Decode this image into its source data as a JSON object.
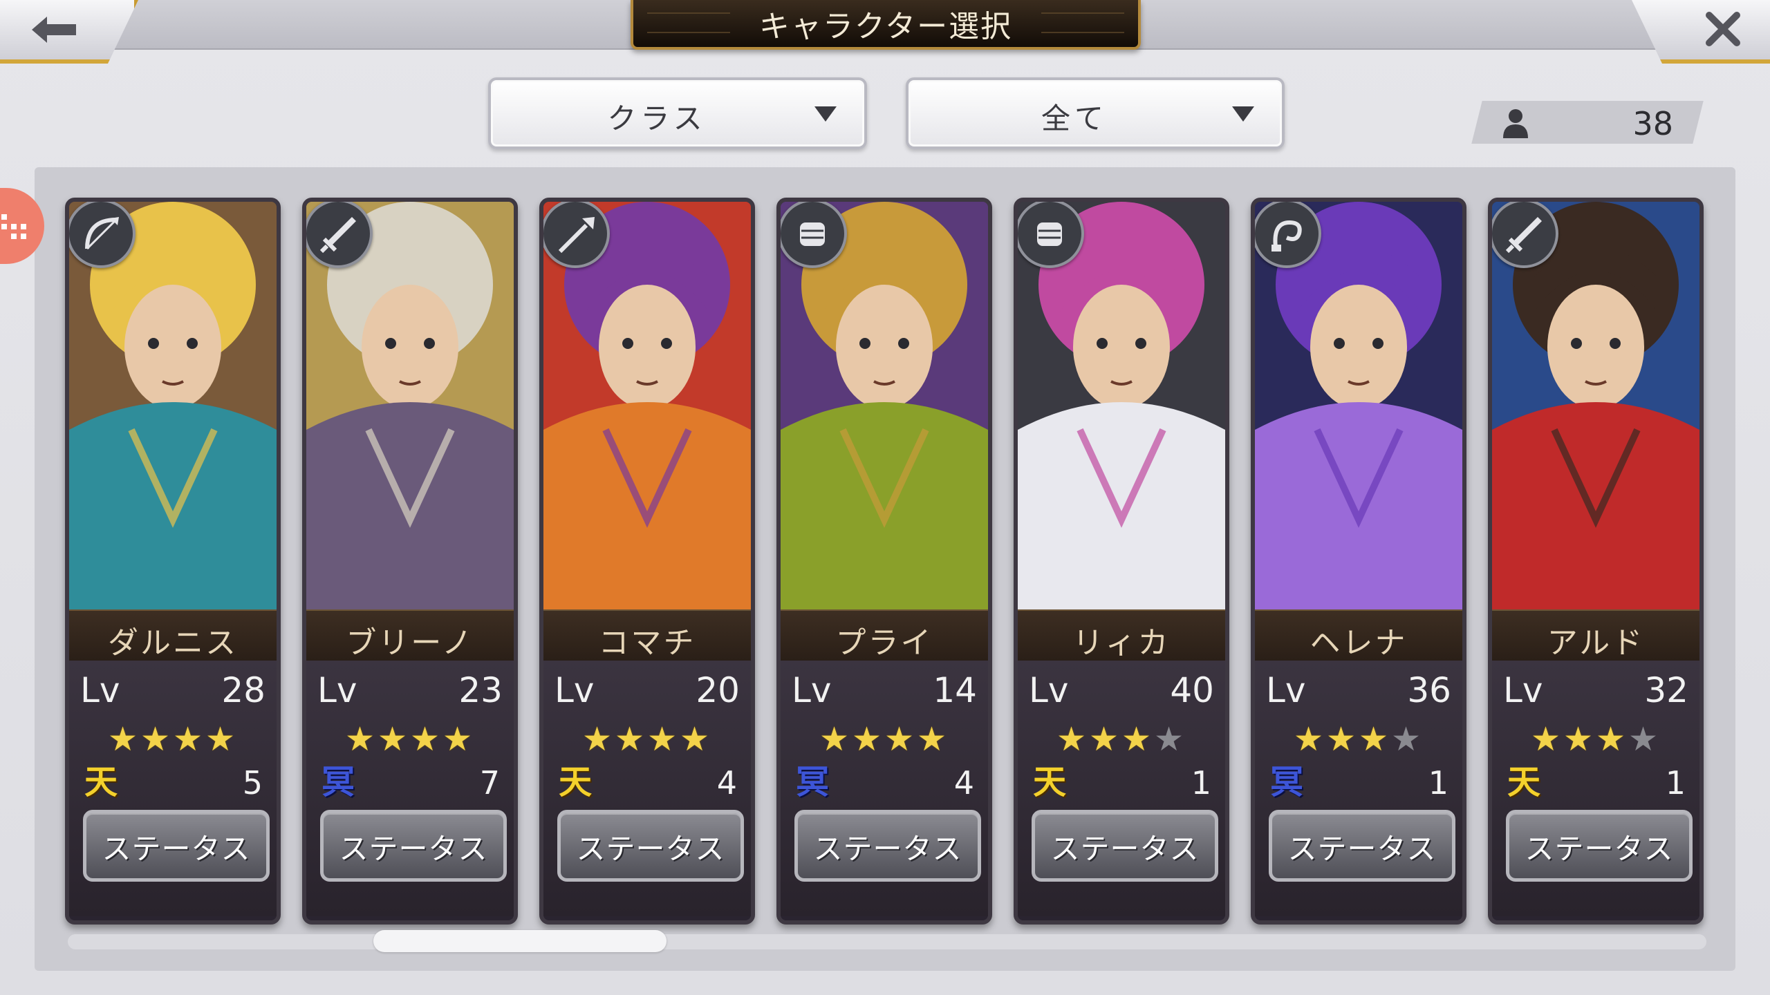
{
  "header": {
    "title": "キャラクター選択",
    "back_icon": "left-arrow-icon",
    "close_icon": "close-icon"
  },
  "filters": {
    "class_dropdown": {
      "label": "クラス"
    },
    "attribute_dropdown": {
      "label": "全て"
    }
  },
  "character_count": {
    "icon": "person-icon",
    "value": "38"
  },
  "characters": [
    {
      "name": "ダルニス",
      "lv_label": "Lv",
      "level": "28",
      "stars": 4,
      "max_stars": 4,
      "attr": "天",
      "attr_count": "5",
      "class_icon": "bow-icon",
      "status_label": "ステータス",
      "palette": [
        "#e8c24a",
        "#2f8d9a",
        "#7a5a3a"
      ]
    },
    {
      "name": "ブリーノ",
      "lv_label": "Lv",
      "level": "23",
      "stars": 4,
      "max_stars": 4,
      "attr": "冥",
      "attr_count": "7",
      "class_icon": "sword-icon",
      "status_label": "ステータス",
      "palette": [
        "#d8d2c2",
        "#6a5a7a",
        "#b59a52"
      ]
    },
    {
      "name": "コマチ",
      "lv_label": "Lv",
      "level": "20",
      "stars": 4,
      "max_stars": 4,
      "attr": "天",
      "attr_count": "4",
      "class_icon": "spear-icon",
      "status_label": "ステータス",
      "palette": [
        "#7a3a9a",
        "#e07a2a",
        "#c23a2a"
      ]
    },
    {
      "name": "プライ",
      "lv_label": "Lv",
      "level": "14",
      "stars": 4,
      "max_stars": 4,
      "attr": "冥",
      "attr_count": "4",
      "class_icon": "fist-icon",
      "status_label": "ステータス",
      "palette": [
        "#c89a3a",
        "#8aa02a",
        "#5a3a7a"
      ]
    },
    {
      "name": "リィカ",
      "lv_label": "Lv",
      "level": "40",
      "stars": 3,
      "max_stars": 4,
      "attr": "天",
      "attr_count": "1",
      "class_icon": "fist-icon",
      "status_label": "ステータス",
      "palette": [
        "#c04aa0",
        "#e8e8ee",
        "#3a3a42"
      ]
    },
    {
      "name": "ヘレナ",
      "lv_label": "Lv",
      "level": "36",
      "stars": 3,
      "max_stars": 4,
      "attr": "冥",
      "attr_count": "1",
      "class_icon": "whip-icon",
      "status_label": "ステータス",
      "palette": [
        "#6a3ab8",
        "#9a6ad8",
        "#2a2a5a"
      ]
    },
    {
      "name": "アルド",
      "lv_label": "Lv",
      "level": "32",
      "stars": 3,
      "max_stars": 4,
      "attr": "天",
      "attr_count": "1",
      "class_icon": "sword-icon",
      "status_label": "ステータス",
      "palette": [
        "#3a2a22",
        "#c02a2a",
        "#2a4a8a"
      ]
    }
  ],
  "scrollbar": {
    "position": 0.2
  }
}
